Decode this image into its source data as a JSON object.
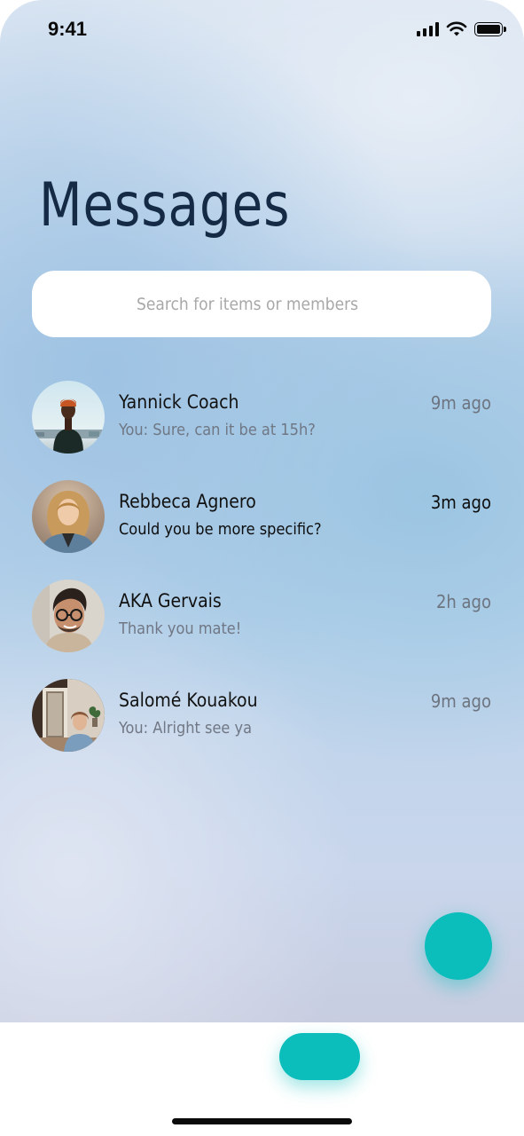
{
  "status_bar": {
    "time": "9:41"
  },
  "page": {
    "title": "Messages"
  },
  "search": {
    "value": "",
    "placeholder": "Search for items or members"
  },
  "conversations": [
    {
      "name": "Yannick Coach",
      "message": "You: Sure, can it be at 15h?",
      "time": "9m ago",
      "unread": false
    },
    {
      "name": "Rebbeca Agnero",
      "message": "Could you be more specific?",
      "time": "3m ago",
      "unread": true
    },
    {
      "name": "AKA Gervais",
      "message": "Thank you mate!",
      "time": "2h ago",
      "unread": false
    },
    {
      "name": "Salomé Kouakou",
      "message": "You: Alright see ya",
      "time": "9m ago",
      "unread": false
    }
  ],
  "colors": {
    "accent": "#0bbdbb",
    "title": "#152b45",
    "read_text": "#707784",
    "unread_text": "#0d0d0d"
  }
}
